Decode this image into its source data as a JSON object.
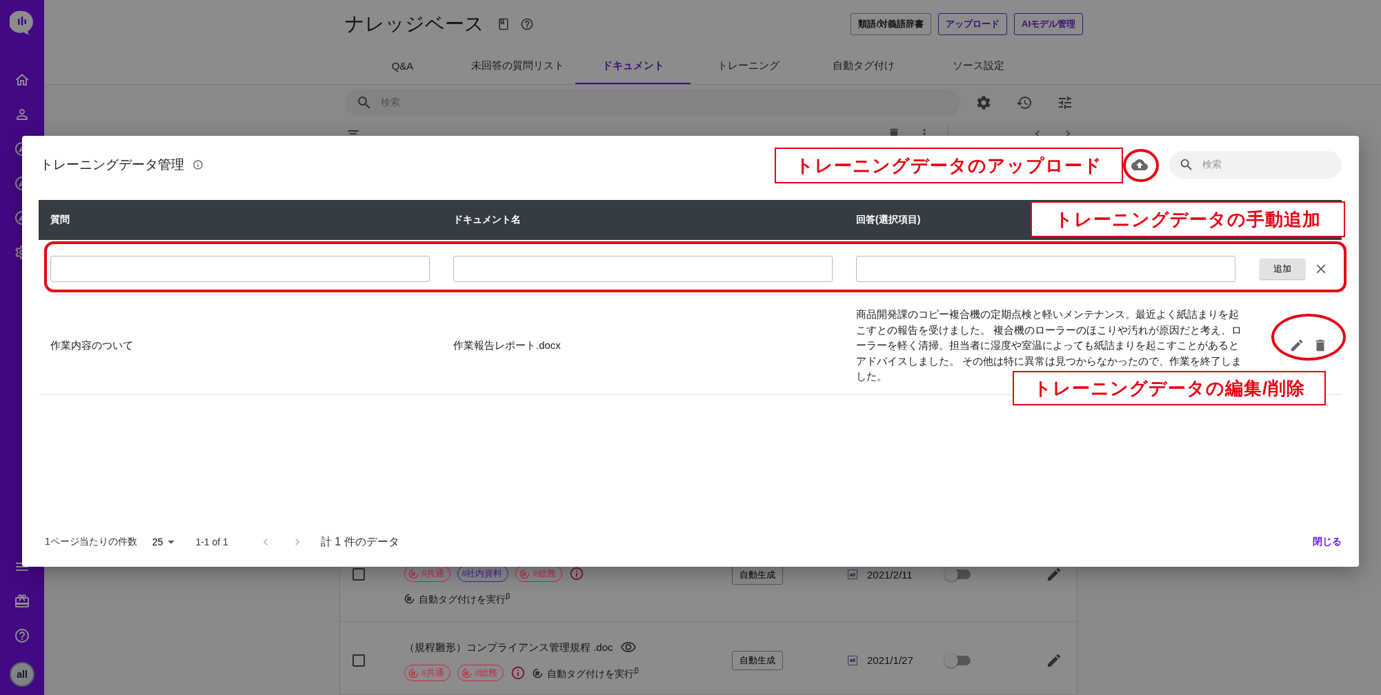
{
  "sidebar": {
    "avatar_label": "all"
  },
  "page": {
    "title": "ナレッジベース",
    "header_buttons": [
      {
        "label": "類語/対義語辞書",
        "kind": "default"
      },
      {
        "label": "アップロード",
        "kind": "primary"
      },
      {
        "label": "AIモデル管理",
        "kind": "primary"
      }
    ],
    "tabs": [
      {
        "label": "Q&A",
        "selected": false
      },
      {
        "label": "未回答の質問リスト",
        "selected": false
      },
      {
        "label": "ドキュメント",
        "selected": true
      },
      {
        "label": "トレーニング",
        "selected": false
      },
      {
        "label": "自動タグ付け",
        "selected": false
      },
      {
        "label": "ソース設定",
        "selected": false
      }
    ],
    "search": {
      "placeholder": "検索"
    },
    "documents": [
      {
        "kind": "wrapped",
        "checked": false,
        "tags": [
          {
            "label": "#共通",
            "color": "#c22a45"
          },
          {
            "label": "#社内資料",
            "color": "#4a1a9e"
          },
          {
            "label": "#総務",
            "color": "#c22a45"
          }
        ],
        "auto_tag": "自動タグ付けを実行",
        "auto_tag_mark": "β",
        "button": "自動生成",
        "source": "all",
        "date": "2021/2/11",
        "on": false
      },
      {
        "kind": "inline",
        "checked": false,
        "title": "（規程雛形）コンプライアンス管理規程 .doc",
        "tags": [
          {
            "label": "#共通",
            "color": "#c22a45"
          },
          {
            "label": "#総務",
            "color": "#c22a45"
          }
        ],
        "auto_tag": "自動タグ付けを実行",
        "auto_tag_mark": "β",
        "button": "自動生成",
        "source": "all",
        "date": "2021/1/27",
        "on": false
      }
    ]
  },
  "modal": {
    "title": "トレーニングデータ管理",
    "search": {
      "placeholder": "検索"
    },
    "columns": [
      "質問",
      "ドキュメント名",
      "回答(選択項目)"
    ],
    "add_button": "追加",
    "rows": [
      {
        "question": "作業内容のついて",
        "document": "作業報告レポート.docx",
        "answer": "商品開発課のコピー複合機の定期点検と軽いメンテナンス。最近よく紙詰まりを起こすとの報告を受けました。 複合機のローラーのほこりや汚れが原因だと考え、ローラーを軽く清掃。担当者に湿度や室温によっても紙詰まりを起こすことがあるとアドバイスしました。 その他は特に異常は見つからなかったので、作業を終了しました。"
      }
    ],
    "footer": {
      "rows_per_page_label": "1ページ当たりの件数",
      "rows_per_page": "25",
      "range": "1-1 of 1",
      "total": "計 1 件のデータ",
      "close": "閉じる"
    }
  },
  "annotations": [
    {
      "kind": "label",
      "text": "トレーニングデータのアップロード"
    },
    {
      "kind": "ellipse"
    },
    {
      "kind": "label",
      "text": "トレーニングデータの手動追加"
    },
    {
      "kind": "frame"
    },
    {
      "kind": "ellipse"
    },
    {
      "kind": "label",
      "text": "トレーニングデータの編集/削除"
    }
  ]
}
